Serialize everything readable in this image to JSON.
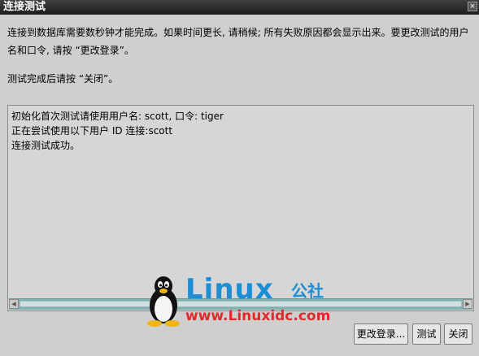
{
  "window": {
    "title": "连接测试",
    "close_glyph": "×"
  },
  "message": {
    "line1": "连接到数据库需要数秒钟才能完成。如果时间更长, 请稍候; 所有失败原因都会显示出来。要更改测试的用户名和口令, 请按 “更改登录”。",
    "line2": "测试完成后请按 “关闭”。"
  },
  "log": {
    "lines": [
      "初始化首次测试请使用用户名: scott, 口令: tiger",
      "正在尝试使用以下用户 ID 连接:scott",
      "连接测试成功。"
    ]
  },
  "watermark": {
    "brand": "Linux",
    "brand_cn": "公社",
    "url": "www.Linuxidc.com"
  },
  "buttons": {
    "change_login": "更改登录...",
    "test": "测试",
    "close": "关闭"
  },
  "colors": {
    "watermark_blue": "#1c8ed6",
    "watermark_red": "#e02a2a",
    "scrollbar": "#7fb2b0"
  }
}
